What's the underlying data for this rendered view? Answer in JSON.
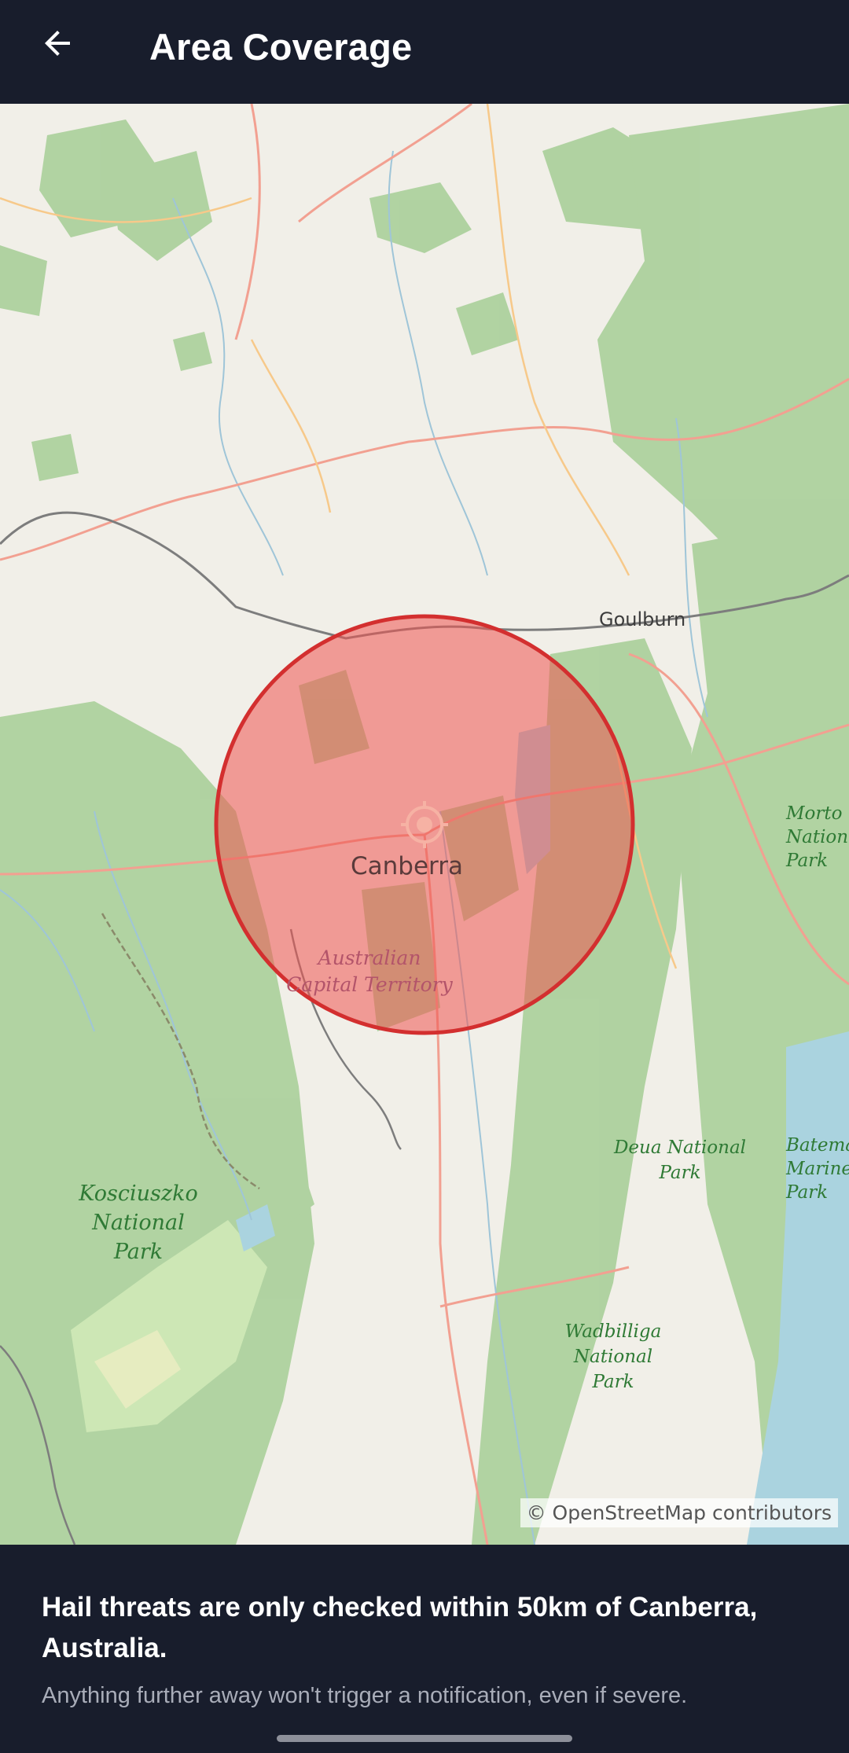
{
  "appbar": {
    "title": "Area Coverage",
    "back_icon": "arrow-back-icon"
  },
  "map": {
    "center_marker_icon": "crosshair-target-icon",
    "coverage_fill_color": "#ef5350",
    "coverage_stroke_color": "#d32f2f",
    "labels": {
      "canberra": "Canberra",
      "goulburn": "Goulburn",
      "act_line1": "Australian",
      "act_line2": "Capital Territory",
      "kosciuszko": [
        "Kosciuszko",
        "National",
        "Park"
      ],
      "deua": [
        "Deua National",
        "Park"
      ],
      "wadbilliga": [
        "Wadbilliga",
        "National",
        "Park"
      ],
      "morton": [
        "Morto",
        "Nation",
        "Park"
      ],
      "batemans": [
        "Batema",
        "Marine",
        "Park"
      ]
    },
    "attribution": "© OpenStreetMap contributors"
  },
  "info": {
    "headline": "Hail threats are only checked within 50km of Canberra, Australia.",
    "subtext": "Anything further away won't trigger a notification, even if severe."
  }
}
